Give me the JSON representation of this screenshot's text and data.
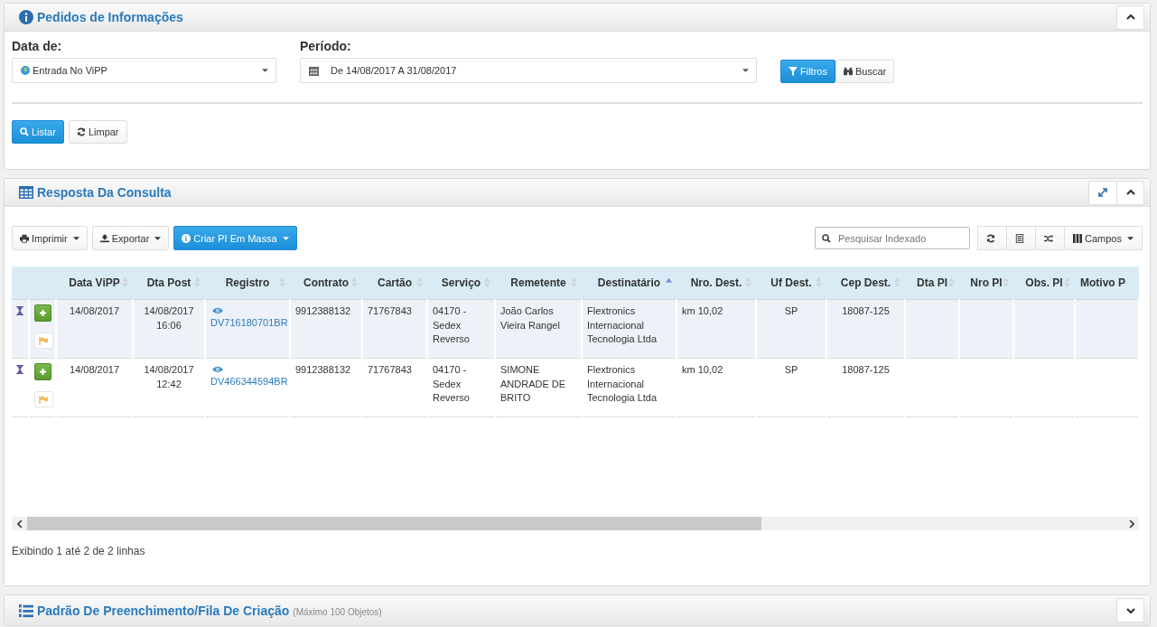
{
  "filter_panel": {
    "title": "Pedidos de Informações",
    "collapsed": false,
    "date_field": {
      "label": "Data de:",
      "value": "Entrada No ViPP"
    },
    "period_field": {
      "label": "Período:",
      "value": "De 14/08/2017 A 31/08/2017"
    },
    "mode_buttons": [
      {
        "label": "Filtros",
        "selected": true,
        "kind": "filter"
      },
      {
        "label": "Buscar",
        "selected": false,
        "kind": "binoculars"
      }
    ],
    "actions": [
      {
        "label": "Listar",
        "kind": "primary"
      },
      {
        "label": "Limpar",
        "kind": "refresh"
      }
    ]
  },
  "results_panel": {
    "title": "Resposta Da Consulta",
    "toolbar": [
      {
        "label": "Imprimir",
        "kind": "print"
      },
      {
        "label": "Exportar",
        "kind": "download"
      },
      {
        "label": "Criar PI Em Massa",
        "kind": "info"
      }
    ],
    "search": {
      "placeholder": "Pesquisar Indexado"
    },
    "columns_button": "Campos",
    "columns": [
      {},
      {},
      {
        "label": "Data ViPP",
        "sorted": false
      },
      {
        "label": "Dta Post",
        "sorted": false
      },
      {
        "label": "Registro",
        "sorted": false
      },
      {
        "label": "Contrato",
        "sorted": false
      },
      {
        "label": "Cartão",
        "sorted": false
      },
      {
        "label": "Serviço",
        "sorted": false
      },
      {
        "label": "Remetente",
        "sorted": false
      },
      {
        "label": "Destinatário",
        "sorted": true
      },
      {
        "label": "Nro. Dest.",
        "sorted": false
      },
      {
        "label": "Uf Dest.",
        "sorted": false
      },
      {
        "label": "Cep Dest.",
        "sorted": false
      },
      {
        "label": "Dta PI",
        "sorted": false
      },
      {
        "label": "Nro PI",
        "sorted": false
      },
      {
        "label": "Obs. PI",
        "sorted": false
      },
      {
        "label": "Motivo P"
      }
    ],
    "rows": [
      {
        "selected": true,
        "data_vipp": "14/08/2017",
        "dta_post": "14/08/2017 16:06",
        "registro": "DV716180701BR",
        "contrato": "9912388132",
        "cartao": "71767843",
        "servico": "04170 - Sedex Reverso",
        "remetente": "João Carlos Vieira Rangel",
        "destinatario": "Flextronics Internacional Tecnologia Ltda",
        "nro_dest": "km 10,02",
        "uf_dest": "SP",
        "cep_dest": "18087-125"
      },
      {
        "selected": false,
        "data_vipp": "14/08/2017",
        "dta_post": "14/08/2017 12:42",
        "registro": "DV466344594BR",
        "contrato": "9912388132",
        "cartao": "71767843",
        "servico": "04170 - Sedex Reverso",
        "remetente": "SIMONE ANDRADE DE BRITO",
        "destinatario": "Flextronics Internacional Tecnologia Ltda",
        "nro_dest": "km 10,02",
        "uf_dest": "SP",
        "cep_dest": "18087-125"
      }
    ],
    "footer": "Exibindo 1 até 2 de 2 linhas"
  },
  "queue_panel": {
    "title": "Padrão De Preenchimento/Fila De Criação",
    "note": "(Máximo 100 Objetos)",
    "collapsed": true
  }
}
